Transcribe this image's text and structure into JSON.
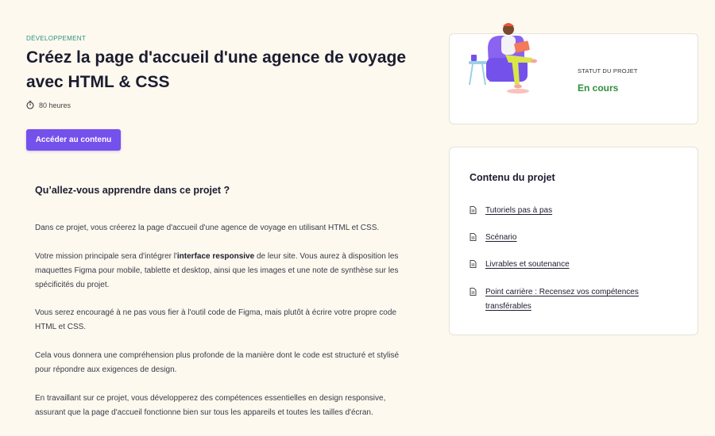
{
  "header": {
    "category": "DÉVELOPPEMENT",
    "title": "Créez la page d'accueil d'une agence de voyage avec HTML & CSS",
    "duration": "80 heures",
    "cta_label": "Accéder au contenu"
  },
  "main": {
    "heading": "Qu’allez-vous apprendre dans ce projet ?",
    "paragraph_1": "Dans ce projet, vous créerez la page d'accueil d'une agence de voyage en utilisant HTML et CSS.",
    "paragraph_2_before": "Votre mission principale sera d'intégrer l'",
    "paragraph_2_bold": "interface responsive",
    "paragraph_2_after": " de leur site. Vous aurez à disposition les maquettes Figma pour mobile, tablette et desktop, ainsi que les images et une note de synthèse sur les spécificités du projet.",
    "paragraph_3": "Vous serez encouragé à ne pas vous fier à l'outil code de Figma, mais plutôt à écrire votre propre code HTML et CSS.",
    "paragraph_4": "Cela vous donnera une compréhension plus profonde de la manière dont le code est structuré et stylisé pour répondre aux exigences de design.",
    "paragraph_5": "En travaillant sur ce projet, vous développerez des compétences essentielles en design responsive, assurant que la page d'accueil fonctionne bien sur tous les appareils et toutes les tailles d'écran."
  },
  "status_card": {
    "label": "STATUT DU PROJET",
    "value": "En cours",
    "value_color": "#2f8f3a"
  },
  "contents_card": {
    "title": "Contenu du projet",
    "items": [
      {
        "label": "Tutoriels pas à pas",
        "icon": "document-icon"
      },
      {
        "label": "Scénario",
        "icon": "document-icon"
      },
      {
        "label": "Livrables et soutenance",
        "icon": "document-icon"
      },
      {
        "label": "Point carrière : Recensez vos compétences transférables",
        "icon": "document-icon"
      }
    ]
  },
  "colors": {
    "background": "#fdf9ef",
    "accent": "#7451eb",
    "category": "#2f8f83"
  }
}
